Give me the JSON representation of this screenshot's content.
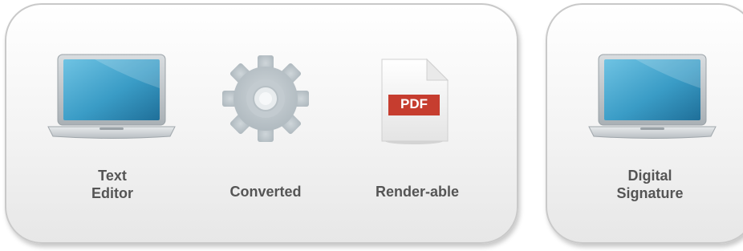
{
  "steps": [
    {
      "id": "text-editor",
      "icon": "laptop-icon",
      "lines": [
        "Text",
        "Editor"
      ]
    },
    {
      "id": "converted",
      "icon": "gear-icon",
      "lines": [
        "Converted"
      ]
    },
    {
      "id": "renderable",
      "icon": "pdf-document-icon",
      "badge": "PDF",
      "lines": [
        "Render-able"
      ]
    },
    {
      "id": "digital-signature",
      "icon": "laptop-icon",
      "lines": [
        "Digital",
        "Signature"
      ]
    }
  ],
  "colors": {
    "label": "#555555",
    "pdf_badge": "#c0392b",
    "screen": "#3fa1c9",
    "gear": "#b6c0c6"
  }
}
